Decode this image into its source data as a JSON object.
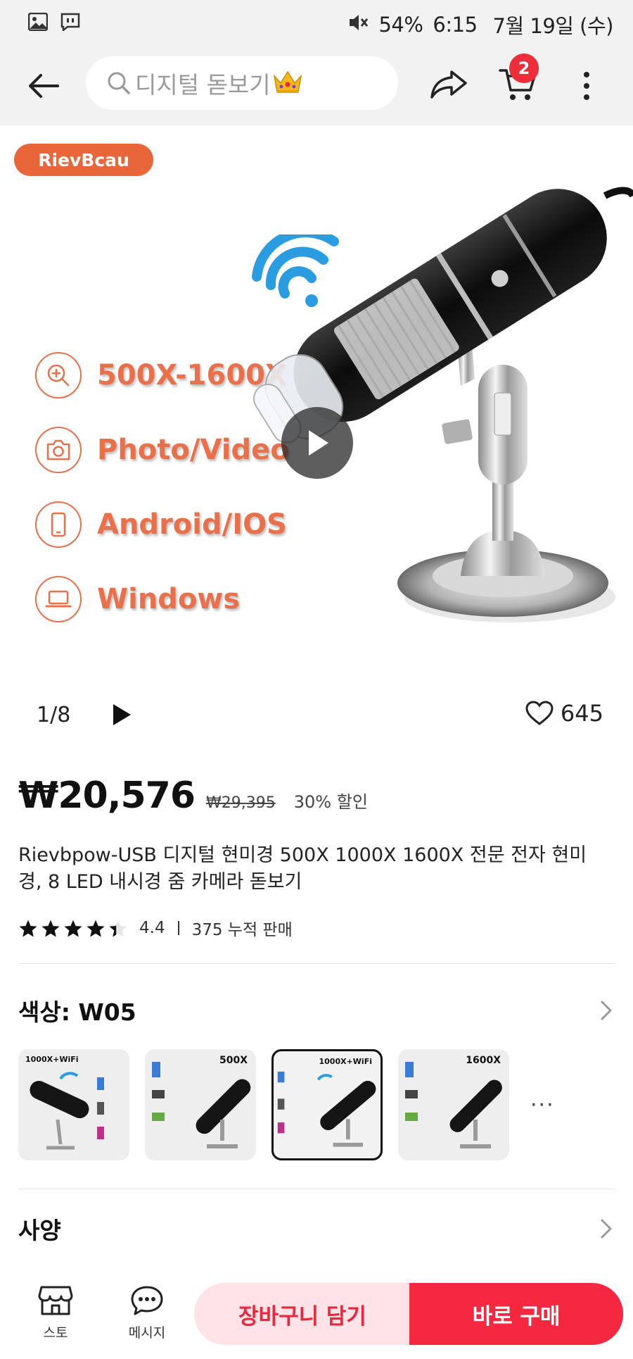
{
  "status_bar": {
    "battery": "54%",
    "time": "6:15",
    "date": "7월 19일 (수)"
  },
  "header": {
    "search_text": "디지털 돋보기",
    "cart_count": "2"
  },
  "gallery": {
    "brand": "RievBcau",
    "features": [
      "500X-1600X",
      "Photo/Video",
      "Android/IOS",
      "Windows"
    ],
    "counter": "1/8",
    "likes": "645"
  },
  "product": {
    "price": "₩20,576",
    "original_price": "₩29,395",
    "discount": "30% 할인",
    "title": "Rievbpow-USB 디지털 현미경 500X 1000X 1600X 전문 전자 현미경, 8 LED 내시경 줌 카메라 돋보기",
    "rating": "4.4",
    "rating_fraction": 0.88,
    "sales": "375 누적 판매"
  },
  "color_option": {
    "label": "색상: W05",
    "thumbnails": [
      "1000X+WiFi",
      "500X",
      "1000X+WiFi",
      "1600X"
    ],
    "selected_index": 2,
    "more": "···"
  },
  "spec": {
    "label": "사양"
  },
  "bottom_bar": {
    "store_label": "스토",
    "message_label": "메시지",
    "add_to_cart": "장바구니 담기",
    "buy_now": "바로 구매"
  },
  "colors": {
    "accent_red": "#f5283f",
    "brand_orange": "#e8663a"
  }
}
